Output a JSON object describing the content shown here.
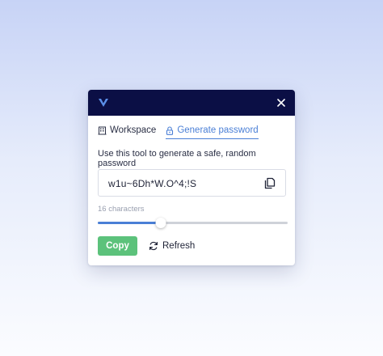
{
  "header": {
    "logo_icon": "chevron-logo-icon",
    "close_icon": "close-icon",
    "background_color": "#0b0f45"
  },
  "tabs": [
    {
      "label": "Workspace",
      "icon": "building-icon",
      "active": false
    },
    {
      "label": "Generate password",
      "icon": "lock-icon",
      "active": true
    }
  ],
  "description": "Use this tool to generate a safe, random password",
  "password": {
    "value": "w1u~6Dh*W.O^4;!S",
    "copy_icon": "copy-icon"
  },
  "length": {
    "label": "16 characters",
    "value": 16,
    "fraction": 0.33
  },
  "actions": {
    "copy_label": "Copy",
    "refresh_label": "Refresh",
    "refresh_icon": "refresh-icon"
  },
  "colors": {
    "accent": "#4a7fd6",
    "copy_button": "#5cc27b"
  }
}
